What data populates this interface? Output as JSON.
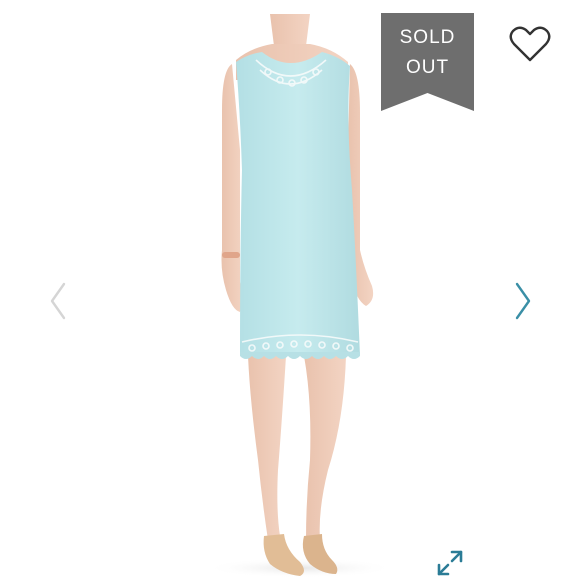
{
  "listing": {
    "status_badge": {
      "line1": "SOLD",
      "line2": "OUT",
      "color": "#6e6e6e"
    },
    "icons": {
      "like": "heart-outline-icon",
      "prev": "chevron-left-icon",
      "next": "chevron-right-icon",
      "fullscreen": "expand-arrows-icon"
    },
    "colors": {
      "dress": "#bfe6ea",
      "nav_prev": "#d5d5d5",
      "nav_next": "#3a8fa6",
      "expand": "#2b7c96"
    }
  }
}
